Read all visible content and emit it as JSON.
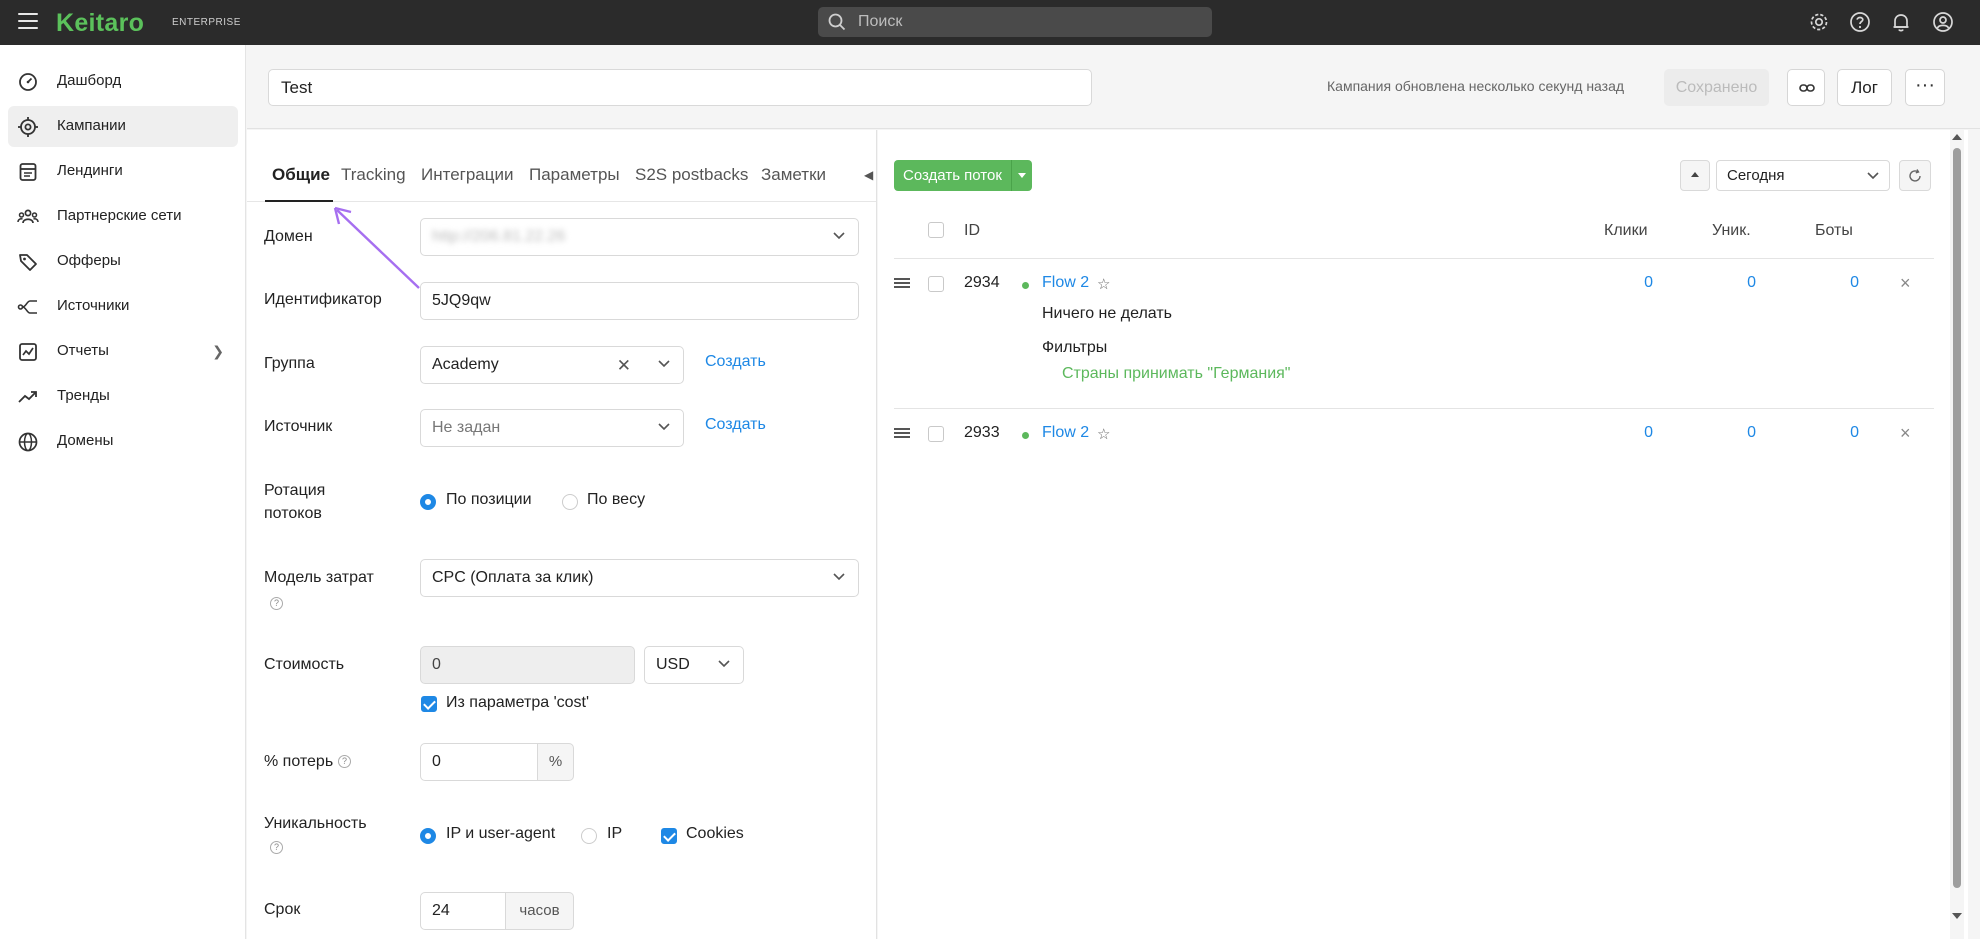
{
  "app": {
    "logo": "Keitaro",
    "edition": "ENTERPRISE",
    "search_placeholder": "Поиск"
  },
  "sidebar": {
    "items": [
      {
        "label": "Дашборд",
        "icon": "dashboard-icon"
      },
      {
        "label": "Кампании",
        "icon": "target-icon",
        "active": true
      },
      {
        "label": "Лендинги",
        "icon": "landing-icon"
      },
      {
        "label": "Партнерские сети",
        "icon": "network-icon"
      },
      {
        "label": "Офферы",
        "icon": "offers-tag-icon"
      },
      {
        "label": "Источники",
        "icon": "sources-icon"
      },
      {
        "label": "Отчеты",
        "icon": "reports-icon",
        "has_children": true
      },
      {
        "label": "Тренды",
        "icon": "trends-icon"
      },
      {
        "label": "Домены",
        "icon": "globe-icon"
      }
    ]
  },
  "header": {
    "campaign_name": "Test",
    "status": "Кампания обновлена несколько секунд назад",
    "saved_label": "Сохранено",
    "log_label": "Лог",
    "more_label": "···"
  },
  "tabs": [
    "Общие",
    "Tracking",
    "Интеграции",
    "Параметры",
    "S2S postbacks",
    "Заметки"
  ],
  "form": {
    "domain_label": "Домен",
    "domain_value": "http://206.81.22.26",
    "identifier_label": "Идентификатор",
    "identifier_value": "5JQ9qw",
    "group_label": "Группа",
    "group_value": "Academy",
    "create_label": "Создать",
    "source_label": "Источник",
    "source_value": "Не задан",
    "rotation_label_1": "Ротация",
    "rotation_label_2": "потоков",
    "rotation_opt_position": "По позиции",
    "rotation_opt_weight": "По весу",
    "cost_model_label": "Модель затрат",
    "cost_model_value": "CPC (Оплата за клик)",
    "cost_label": "Стоимость",
    "cost_value": "0",
    "currency_value": "USD",
    "cost_param_label": "Из параметра 'cost'",
    "loss_label": "% потерь",
    "loss_value": "0",
    "loss_unit": "%",
    "uniq_label": "Уникальность",
    "uniq_opt_ip_ua": "IP и user-agent",
    "uniq_opt_ip": "IP",
    "uniq_opt_cookies": "Cookies",
    "term_label": "Срок",
    "term_value": "24",
    "term_unit": "часов"
  },
  "flows": {
    "create_label": "Создать поток",
    "period_value": "Сегодня",
    "columns": {
      "id": "ID",
      "clicks": "Клики",
      "unique": "Уник.",
      "bots": "Боты"
    },
    "rows": [
      {
        "id": "2934",
        "name": "Flow 2",
        "action": "Ничего не делать",
        "filters_label": "Фильтры",
        "filter_rule": "Страны принимать \"Германия\"",
        "clicks": "0",
        "unique": "0",
        "bots": "0"
      },
      {
        "id": "2933",
        "name": "Flow 2",
        "clicks": "0",
        "unique": "0",
        "bots": "0"
      }
    ]
  },
  "colors": {
    "accent": "#1e88e5",
    "brand_green": "#5bc15b",
    "topbar": "#2b2b2b"
  }
}
